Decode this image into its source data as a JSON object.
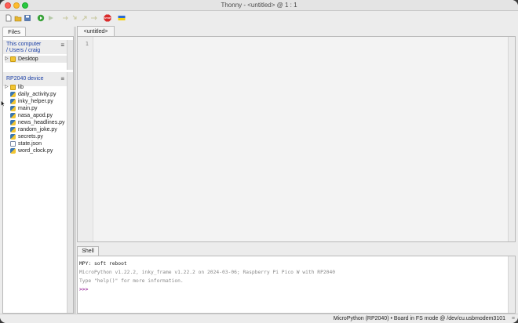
{
  "window": {
    "title": "Thonny  -  <untitled>  @  1 : 1"
  },
  "toolbar": {
    "buttons": [
      {
        "name": "new-file-button",
        "icon": "new-file-icon"
      },
      {
        "name": "open-file-button",
        "icon": "folder-open-icon"
      },
      {
        "name": "save-file-button",
        "icon": "save-icon"
      },
      {
        "name": "run-button",
        "icon": "run-icon"
      },
      {
        "name": "debug-button",
        "icon": "debug-icon"
      },
      {
        "name": "step-over-button",
        "icon": "step-over-icon"
      },
      {
        "name": "step-into-button",
        "icon": "step-into-icon"
      },
      {
        "name": "step-out-button",
        "icon": "step-out-icon"
      },
      {
        "name": "resume-button",
        "icon": "resume-icon"
      },
      {
        "name": "stop-button",
        "icon": "stop-icon"
      },
      {
        "name": "support-ukraine-button",
        "icon": "ukraine-flag-icon"
      }
    ],
    "stop_label": "STOP"
  },
  "files_panel": {
    "tab_label": "Files",
    "this_computer": {
      "title": "This computer",
      "path": "/ Users / craig",
      "items": [
        {
          "label": "Desktop",
          "type": "folder"
        }
      ]
    },
    "device": {
      "title": "RP2040 device",
      "items": [
        {
          "label": "lib",
          "type": "folder"
        },
        {
          "label": "daily_activity.py",
          "type": "py"
        },
        {
          "label": "inky_helper.py",
          "type": "py"
        },
        {
          "label": "main.py",
          "type": "py"
        },
        {
          "label": "nasa_apod.py",
          "type": "py"
        },
        {
          "label": "news_headlines.py",
          "type": "py"
        },
        {
          "label": "random_joke.py",
          "type": "py"
        },
        {
          "label": "secrets.py",
          "type": "py"
        },
        {
          "label": "state.json",
          "type": "json"
        },
        {
          "label": "word_clock.py",
          "type": "py"
        }
      ]
    },
    "menu_glyph": "≡"
  },
  "editor": {
    "tab_label": "<untitled>",
    "line_numbers": [
      "1"
    ]
  },
  "shell": {
    "tab_label": "Shell",
    "lines": [
      {
        "text": "  MPY: soft reboot",
        "color": "#222222"
      },
      {
        "text": "MicroPython v1.22.2, inky_frame v1.22.2 on 2024-03-06; Raspberry Pi Pico W with RP2040",
        "color": "#8a8a8a"
      },
      {
        "text": "Type \"help()\" for more information.",
        "color": "#8a8a8a"
      },
      {
        "text": ">>>",
        "color": "#9b2c9b"
      }
    ]
  },
  "statusbar": {
    "text": "MicroPython (RP2040)  •  Board in FS mode @ /dev/cu.usbmodem3101",
    "grip": "≡"
  },
  "colors": {
    "accent_blue": "#1a3ea5",
    "prompt_purple": "#9b2c9b"
  }
}
